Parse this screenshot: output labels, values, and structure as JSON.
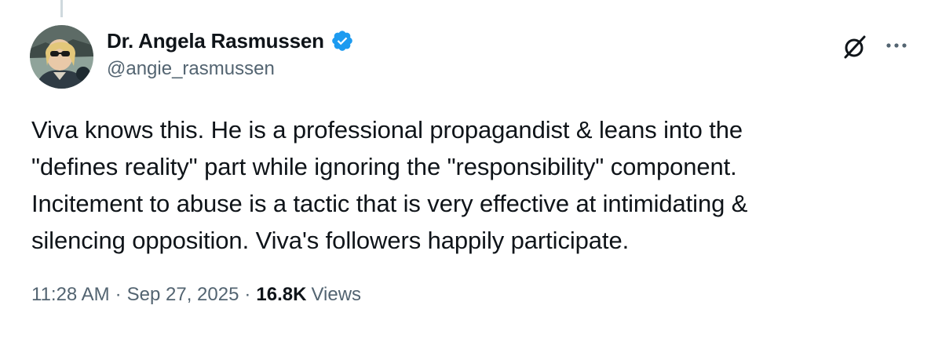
{
  "tweet": {
    "author": {
      "display_name": "Dr. Angela Rasmussen",
      "handle": "@angie_rasmussen",
      "verified": true,
      "avatar_icon": "profile-photo"
    },
    "text": "Viva knows this. He is a professional propagandist & leans into the\n\"defines reality\" part while ignoring the \"responsibility\" component.\nIncitement to abuse is a tactic that is very effective at intimidating &\nsilencing opposition. Viva's followers happily participate.",
    "time": "11:28 AM",
    "separator": "·",
    "date": "Sep 27, 2025",
    "views_count": "16.8K",
    "views_label": "Views"
  },
  "icons": {
    "verified": "verified-badge-icon",
    "grok": "grok-icon",
    "more": "more-options-icon"
  },
  "colors": {
    "text_primary": "#0f1419",
    "text_secondary": "#536471",
    "verified_blue": "#1d9bf0",
    "thread_line": "#cfd9de"
  }
}
